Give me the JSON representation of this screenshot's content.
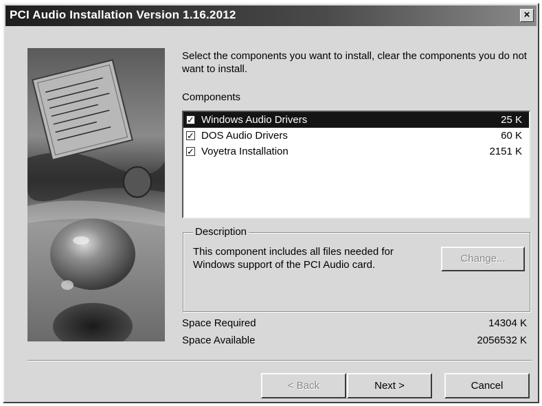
{
  "window": {
    "title": "PCI Audio Installation Version 1.16.2012",
    "close_glyph": "×"
  },
  "intro_text": "Select the components you want to install, clear the components you do not want to install.",
  "components_label": "Components",
  "components": [
    {
      "name": "Windows Audio Drivers",
      "size": "25 K",
      "checked": true,
      "selected": true
    },
    {
      "name": "DOS Audio Drivers",
      "size": "60 K",
      "checked": true,
      "selected": false
    },
    {
      "name": "Voyetra Installation",
      "size": "2151 K",
      "checked": true,
      "selected": false
    }
  ],
  "description": {
    "legend": "Description",
    "text": "This component includes all files needed for Windows support of the PCI Audio card.",
    "change_button": "Change..."
  },
  "space": {
    "required_label": "Space Required",
    "required_value": "14304 K",
    "available_label": "Space Available",
    "available_value": "2056532 K"
  },
  "buttons": {
    "back": "< Back",
    "next": "Next >",
    "cancel": "Cancel"
  },
  "colors": {
    "dialog_bg": "#d8d8d8",
    "selection": "#141414",
    "titlebar": "#1e1e1e"
  }
}
